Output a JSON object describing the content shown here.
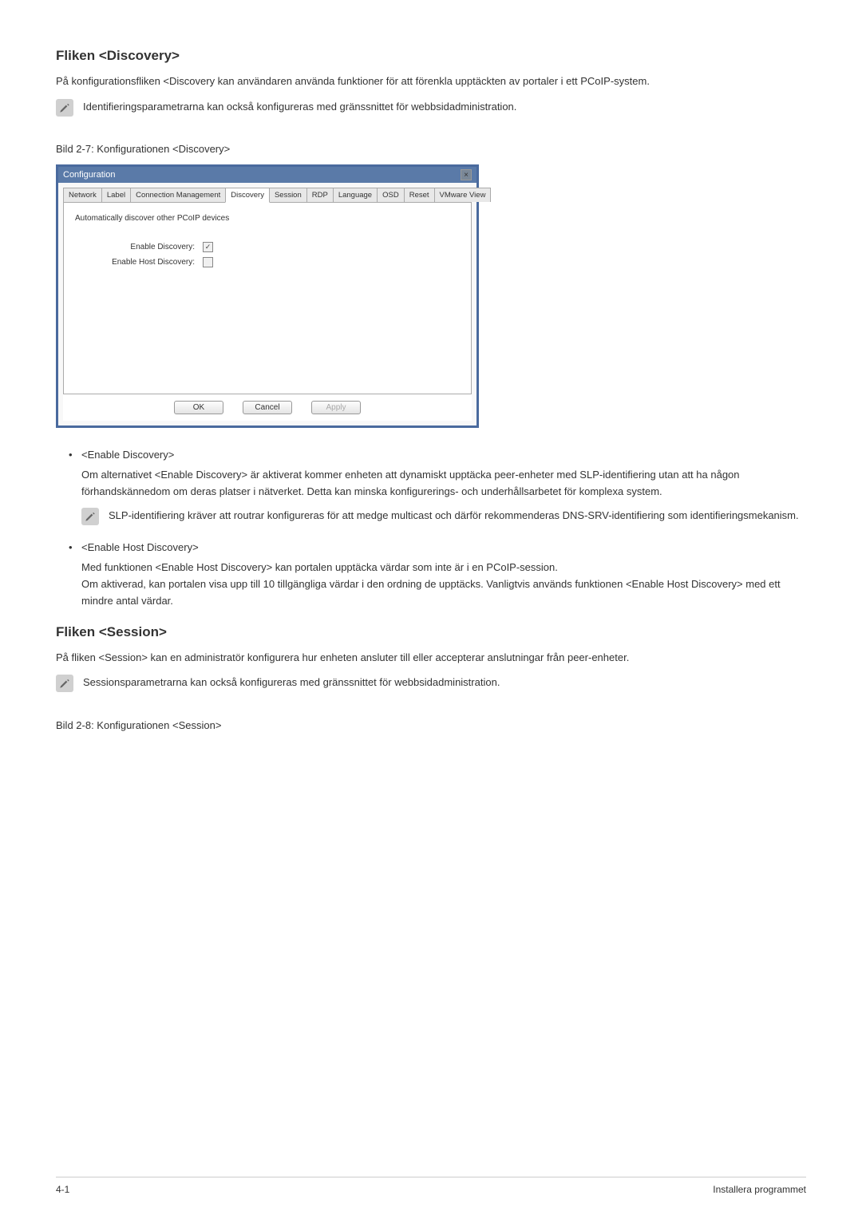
{
  "section1": {
    "heading": "Fliken <Discovery>",
    "intro": "På konfigurationsfliken <Discovery kan användaren använda funktioner för att förenkla upptäckten av portaler i ett PCoIP-system.",
    "note": "Identifieringsparametrarna kan också konfigureras med gränssnittet för webbsidadministration.",
    "caption": "Bild 2-7: Konfigurationen <Discovery>"
  },
  "dialog": {
    "title": "Configuration",
    "tabs": [
      "Network",
      "Label",
      "Connection Management",
      "Discovery",
      "Session",
      "RDP",
      "Language",
      "OSD",
      "Reset",
      "VMware View"
    ],
    "active_tab": "Discovery",
    "desc": "Automatically discover other PCoIP devices",
    "fields": {
      "enable_discovery_label": "Enable Discovery:",
      "enable_discovery_checked": true,
      "enable_host_label": "Enable Host Discovery:",
      "enable_host_checked": false
    },
    "buttons": {
      "ok": "OK",
      "cancel": "Cancel",
      "apply": "Apply"
    }
  },
  "bullets1": [
    {
      "title": "<Enable Discovery>",
      "text": "Om alternativet <Enable Discovery> är aktiverat kommer enheten att dynamiskt upptäcka peer-enheter med SLP-identifiering utan att ha någon förhandskännedom om deras platser i nätverket. Detta kan minska konfigurerings- och underhållsarbetet för komplexa system.",
      "note": "SLP-identifiering kräver att routrar konfigureras för att medge multicast och därför rekommenderas DNS-SRV-identifiering som identifieringsmekanism."
    },
    {
      "title": "<Enable Host Discovery>",
      "text": "Med funktionen <Enable Host Discovery> kan portalen upptäcka värdar som inte är i en PCoIP-session.\nOm aktiverad, kan portalen visa upp till 10 tillgängliga värdar i den ordning de upptäcks. Vanligtvis används funktionen <Enable Host Discovery> med ett mindre antal värdar."
    }
  ],
  "section2": {
    "heading": "Fliken <Session>",
    "intro": "På fliken <Session> kan en administratör konfigurera hur enheten ansluter till eller accepterar anslutningar från peer-enheter.",
    "note": "Sessionsparametrarna kan också konfigureras med gränssnittet för webbsidadministration.",
    "caption": "Bild 2-8: Konfigurationen <Session>"
  },
  "footer": {
    "left": "4-1",
    "right": "Installera programmet"
  }
}
